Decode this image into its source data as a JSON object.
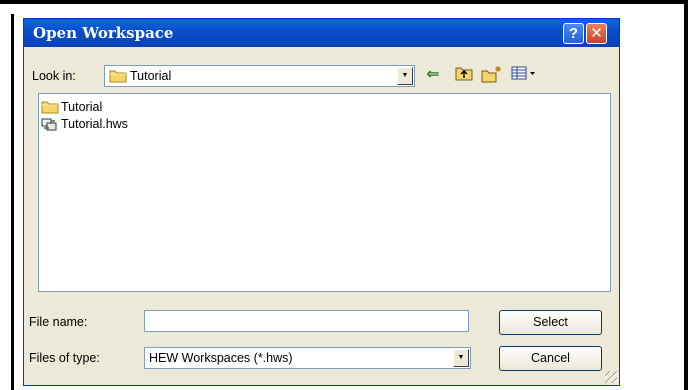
{
  "dialog": {
    "title": "Open Workspace",
    "help_glyph": "?",
    "close_glyph": "✕"
  },
  "look_in": {
    "label": "Look in:",
    "value": "Tutorial",
    "icon": "folder-icon"
  },
  "toolbar": {
    "items": [
      {
        "name": "back",
        "icon": "back-arrow-icon"
      },
      {
        "name": "up-one-level",
        "icon": "up-folder-icon"
      },
      {
        "name": "create-new-folder",
        "icon": "new-folder-icon"
      },
      {
        "name": "view-menu",
        "icon": "view-menu-icon"
      }
    ]
  },
  "files": [
    {
      "name": "Tutorial",
      "icon": "folder-icon"
    },
    {
      "name": "Tutorial.hws",
      "icon": "workspace-file-icon"
    }
  ],
  "file_name": {
    "label": "File name:",
    "value": ""
  },
  "file_type": {
    "label": "Files of type:",
    "value": "HEW Workspaces (*.hws)"
  },
  "buttons": {
    "select": "Select",
    "cancel": "Cancel"
  },
  "colors": {
    "titlebar": "#0a4fcb",
    "dialog_bg": "#ece9d8",
    "border": "#7f9db9"
  }
}
